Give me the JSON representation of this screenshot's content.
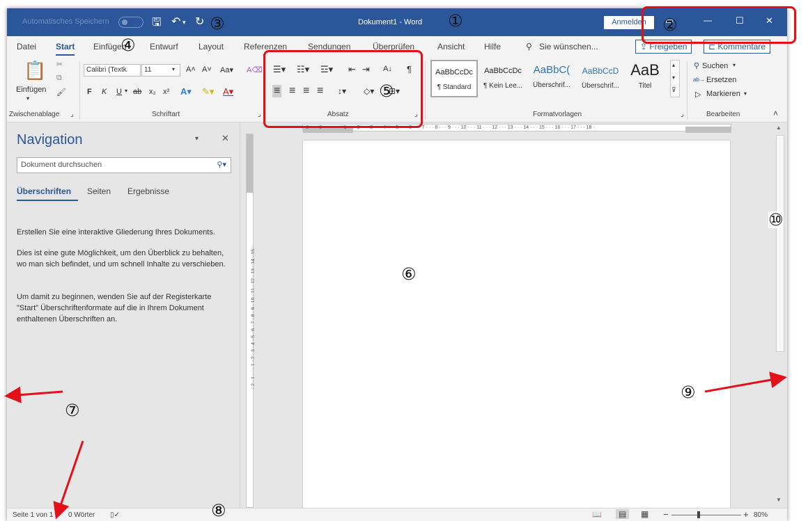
{
  "titlebar": {
    "autosave_label": "Automatisches Speichern",
    "autosave_state": "off",
    "save_glyph": "🖫",
    "undo_glyph": "↶",
    "undo_dd_glyph": "▾",
    "redo_glyph": "↻",
    "document_title": "Dokument1 - Word",
    "signin_label": "Anmelden",
    "ribbon_options_glyph": "▭",
    "minimize_glyph": "—",
    "maximize_glyph": "☐",
    "close_glyph": "✕"
  },
  "tabs": [
    {
      "label": "Datei",
      "active": false
    },
    {
      "label": "Start",
      "active": true
    },
    {
      "label": "Einfügen",
      "active": false
    },
    {
      "label": "Entwurf",
      "active": false
    },
    {
      "label": "Layout",
      "active": false
    },
    {
      "label": "Referenzen",
      "active": false
    },
    {
      "label": "Sendungen",
      "active": false
    },
    {
      "label": "Überprüfen",
      "active": false
    },
    {
      "label": "Ansicht",
      "active": false
    },
    {
      "label": "Hilfe",
      "active": false
    }
  ],
  "tellme": {
    "glyph": "⚲",
    "placeholder": "Sie wünschen..."
  },
  "share_label": "⇪ Freigeben",
  "comments_label": "⊏ Kommentare",
  "ribbon": {
    "clipboard": {
      "paste_glyph": "📋",
      "paste_label": "Einfügen",
      "paste_dd": "▾",
      "cut_glyph": "✂",
      "copy_glyph": "⧉",
      "painter_glyph": "🖌",
      "group_label": "Zwischenablage",
      "launcher_glyph": "⌟"
    },
    "font": {
      "font_name": "Calibri (Textk",
      "font_size": "11",
      "dd_glyph": "▾",
      "grow_glyph": "A˄",
      "shrink_glyph": "A˅",
      "case_glyph": "Aa▾",
      "clear_glyph": "A⌫",
      "bold": "F",
      "italic": "K",
      "underline": "U",
      "underline_dd": "▾",
      "strike": "ab",
      "subscript": "x₂",
      "superscript": "x²",
      "effects_glyph": "A▾",
      "highlight_glyph": "✎▾",
      "color_glyph": "A▾",
      "group_label": "Schriftart",
      "launcher_glyph": "⌟"
    },
    "paragraph": {
      "bullets_glyph": "☰▾",
      "numbering_glyph": "☷▾",
      "multilevel_glyph": "☲▾",
      "dec_indent_glyph": "⇤",
      "inc_indent_glyph": "⇥",
      "sort_glyph": "A↓",
      "pilcrow_glyph": "¶",
      "align_left_glyph": "≡",
      "center_glyph": "≡",
      "align_right_glyph": "≡",
      "justify_glyph": "≡",
      "spacing_glyph": "↕▾",
      "shading_glyph": "◇▾",
      "border_glyph": "⊞▾",
      "group_label": "Absatz",
      "launcher_glyph": "⌟"
    },
    "styles": {
      "items": [
        {
          "preview": "AaBbCcDc",
          "name": "¶ Standard",
          "selected": true
        },
        {
          "preview": "AaBbCcDc",
          "name": "¶ Kein Lee...",
          "selected": false
        },
        {
          "preview": "AaBbC(",
          "name": "Überschrif...",
          "selected": false
        },
        {
          "preview": "AaBbCcD",
          "name": "Überschrif...",
          "selected": false
        },
        {
          "preview": "AaB",
          "name": "Titel",
          "selected": false
        }
      ],
      "scroll_up": "▴",
      "scroll_down": "▾",
      "more": "⊽",
      "group_label": "Formatvorlagen",
      "launcher_glyph": "⌟"
    },
    "editing": {
      "find_label": "Suchen",
      "find_glyph": "⚲",
      "find_dd": "▾",
      "replace_label": "Ersetzen",
      "replace_glyph": "ab→",
      "select_label": "Markieren",
      "select_glyph": "▷",
      "select_dd": "▾",
      "group_label": "Bearbeiten"
    },
    "collapse_glyph": "˄"
  },
  "nav": {
    "title": "Navigation",
    "menu_glyph": "▾",
    "close_glyph": "✕",
    "search_placeholder": "Dokument durchsuchen",
    "search_glyph": "⚲▾",
    "tabs": [
      "Überschriften",
      "Seiten",
      "Ergebnisse"
    ],
    "para1": "Erstellen Sie eine interaktive Gliederung Ihres Dokuments.",
    "para2": "Dies ist eine gute Möglichkeit, um den Überblick zu behalten, wo man sich befindet, und um schnell Inhalte zu verschieben.",
    "para3": "Um damit zu beginnen, wenden Sie auf der Registerkarte \"Start\" Überschriftenformate auf die in Ihrem Dokument enthaltenen Überschriften an."
  },
  "ruler": {
    "corner_glyph": "∟",
    "top_ticks": "· 2 · · · 1 · · · · · · · 1 · · · 2 · · · 3 · · · 4 · · · 5 · · · 6 · · · 7 · · · 8 · · · 9 · · · 10 · · · 11 · · · 12 · · · 13 · · · 14 · · · 15 · · · 16 · · · 17 · · · 18 ·",
    "left_ticks": "· 2 · 1 · · · 1 · 2 · 3 · 4 · 5 · 6 · 7 · 8 · 9 · 10 · 11 · 12 · 13 · 14 · 15 ·"
  },
  "scrollbar": {
    "up_glyph": "▲",
    "down_glyph": "▼"
  },
  "status": {
    "page": "Seite 1 von 1",
    "words": "0 Wörter",
    "proof_glyph": "▯✓",
    "read_glyph": "📖",
    "print_glyph": "▤",
    "web_glyph": "▦",
    "zoom_minus": "−",
    "zoom_plus": "+",
    "zoom": "80%",
    "zoom_level_pct": 80
  },
  "annotations": {
    "c1": "①",
    "c2": "②",
    "c3": "③",
    "c4": "④",
    "c5": "⑤",
    "c6": "⑥",
    "c7": "⑦",
    "c8": "⑧",
    "c9": "⑨",
    "c10": "⑩"
  },
  "colors": {
    "titlebar": "#2b579a",
    "annotation_red": "#e3101a",
    "ribbon_bg": "#f3f3f3",
    "workspace_bg": "#e6e6e6"
  }
}
